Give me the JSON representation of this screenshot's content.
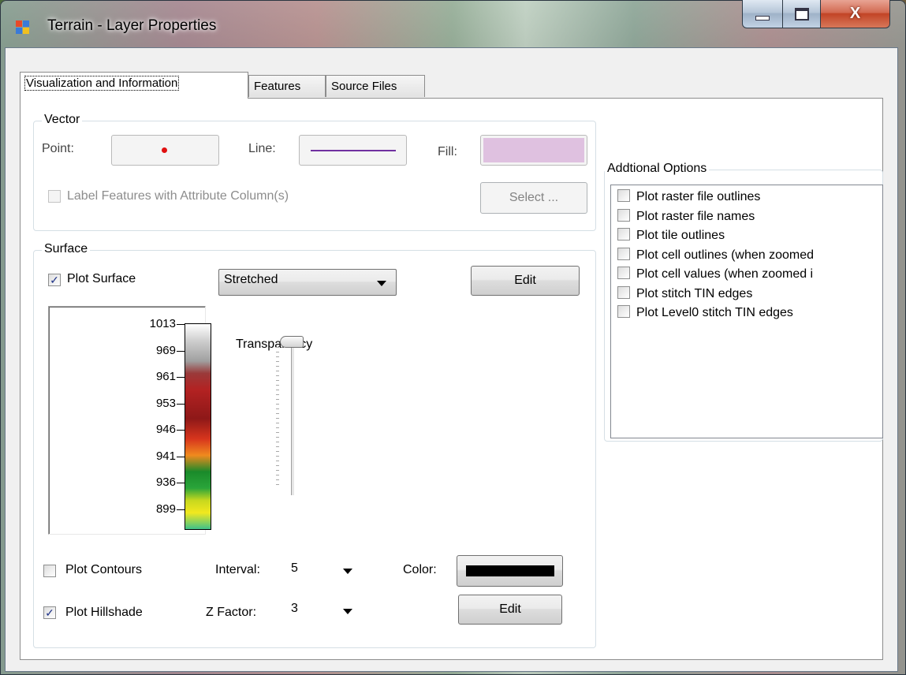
{
  "window": {
    "title": "Terrain - Layer Properties",
    "close_glyph": "X"
  },
  "tabs": [
    {
      "label": "Visualization and Information",
      "active": true
    },
    {
      "label": "Features",
      "active": false
    },
    {
      "label": "Source Files",
      "active": false
    }
  ],
  "vector": {
    "group_title": "Vector",
    "point_label": "Point:",
    "point_color": "#e01010",
    "line_label": "Line:",
    "line_color": "#7030a0",
    "fill_label": "Fill:",
    "fill_color": "#dfc1e0",
    "label_features": {
      "label": "Label Features with Attribute Column(s)",
      "checked": false,
      "enabled": false
    },
    "select_button": "Select ..."
  },
  "surface": {
    "group_title": "Surface",
    "plot_surface": {
      "label": "Plot Surface",
      "checked": true
    },
    "render_mode": "Stretched",
    "edit_button": "Edit",
    "legend_ticks": [
      "1013",
      "969",
      "961",
      "953",
      "946",
      "941",
      "936",
      "899"
    ],
    "transparency_label": "Transparency",
    "transparency_value": 0.0,
    "plot_contours": {
      "label": "Plot Contours",
      "checked": false
    },
    "interval_label": "Interval:",
    "interval_value": "5",
    "color_label": "Color:",
    "contour_color": "#000000",
    "plot_hillshade": {
      "label": "Plot Hillshade",
      "checked": true
    },
    "zfactor_label": "Z Factor:",
    "zfactor_value": "3",
    "hillshade_edit_button": "Edit"
  },
  "additional_options": {
    "group_title": "Addtional Options",
    "items": [
      {
        "label": "Plot raster file outlines",
        "checked": false
      },
      {
        "label": "Plot raster file names",
        "checked": false
      },
      {
        "label": "Plot tile outlines",
        "checked": false
      },
      {
        "label": "Plot cell outlines (when zoomed",
        "checked": false
      },
      {
        "label": "Plot cell values (when zoomed i",
        "checked": false
      },
      {
        "label": "Plot stitch TIN edges",
        "checked": false
      },
      {
        "label": "Plot Level0 stitch TIN edges",
        "checked": false
      }
    ]
  },
  "icons": {
    "app": "layer-properties-icon",
    "minimize": "minimize-icon",
    "maximize": "maximize-icon",
    "close": "close-icon",
    "dropdown": "chevron-down-icon",
    "checkmark": "checkmark-icon"
  }
}
